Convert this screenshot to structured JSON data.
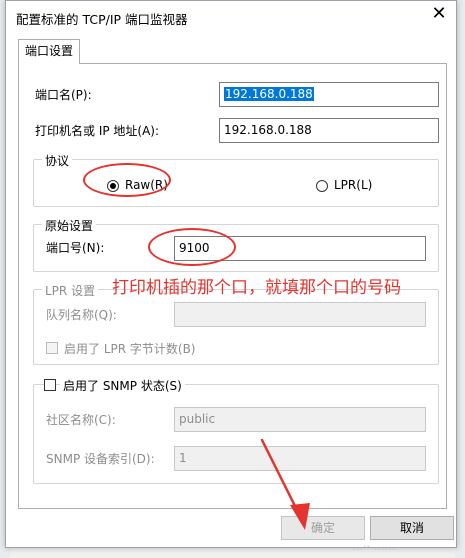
{
  "dialog": {
    "title": "配置标准的 TCP/IP 端口监视器",
    "close_glyph": "✕"
  },
  "tabs": [
    {
      "label": "端口设置"
    }
  ],
  "port_name": {
    "label": "端口名(P):",
    "value": "192.168.0.188"
  },
  "printer_name": {
    "label": "打印机名或 IP 地址(A):",
    "value": "192.168.0.188"
  },
  "protocol": {
    "title": "协议",
    "raw_label": "Raw(R)",
    "lpr_label": "LPR(L)",
    "selected": "Raw"
  },
  "raw_settings": {
    "title": "原始设置",
    "port_number_label": "端口号(N):",
    "port_number_value": "9100"
  },
  "annotation": {
    "text": "打印机插的那个口，就填那个口的号码",
    "color": "#e3342f"
  },
  "lpr_settings": {
    "title": "LPR 设置",
    "queue_label": "队列名称(Q):",
    "queue_value": "",
    "byte_count_label": "启用了 LPR 字节计数(B)"
  },
  "snmp": {
    "title": "启用了 SNMP 状态(S)",
    "community_label": "社区名称(C):",
    "community_value": "public",
    "index_label": "SNMP 设备索引(D):",
    "index_value": "1"
  },
  "buttons": {
    "ok": "确定",
    "cancel": "取消"
  },
  "watermark": "…·· ……"
}
